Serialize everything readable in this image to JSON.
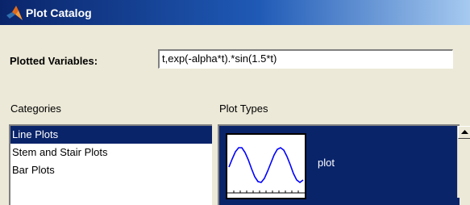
{
  "window": {
    "title": "Plot Catalog",
    "icon": "matlab-logo-icon",
    "titlebar_colors": [
      "#0a246a",
      "#1f5ab6",
      "#a6caf0"
    ]
  },
  "plotted_variables": {
    "label": "Plotted Variables:",
    "value": "t,exp(-alpha*t).*sin(1.5*t)"
  },
  "categories": {
    "heading": "Categories",
    "items": [
      {
        "label": "Line Plots",
        "selected": true
      },
      {
        "label": "Stem and Stair Plots",
        "selected": false
      },
      {
        "label": "Bar Plots",
        "selected": false
      }
    ]
  },
  "plot_types": {
    "heading": "Plot Types",
    "items": [
      {
        "label": "plot",
        "icon": "sine-plot-thumbnail-icon",
        "selected": true
      }
    ]
  },
  "colors": {
    "selection": "#0a246a",
    "plot_line": "#0000ff",
    "face": "#ece9d8"
  }
}
